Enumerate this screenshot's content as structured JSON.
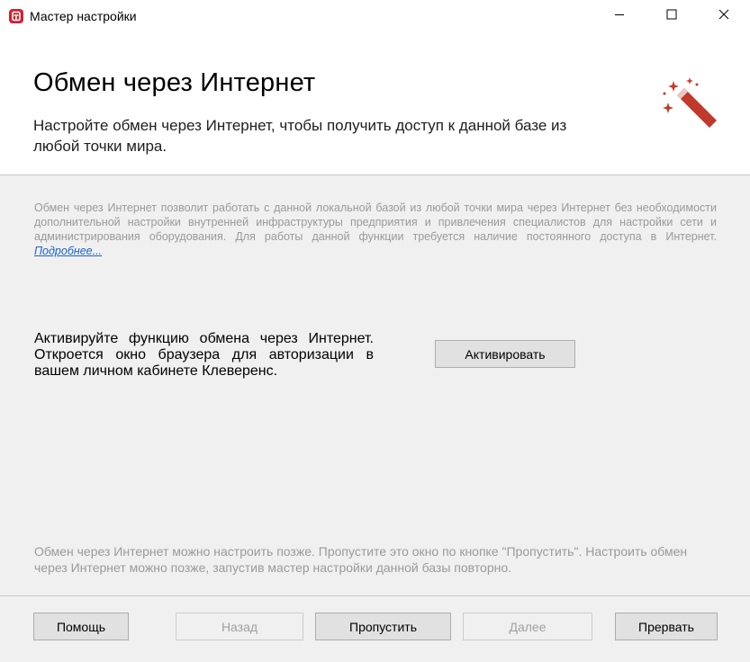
{
  "window": {
    "title": "Мастер настройки",
    "icon": "app-logo-icon",
    "controls": [
      "minimize-icon",
      "maximize-icon",
      "close-icon"
    ]
  },
  "header": {
    "title": "Обмен через Интернет",
    "subtitle": "Настройте обмен через Интернет, чтобы получить доступ к данной базе из любой точки мира.",
    "icon": "magic-wand-icon"
  },
  "info": {
    "text": "Обмен через Интернет позволит работать с данной локальной базой из любой точки мира через Интернет без необходимости дополнительной настройки внутренней инфраструктуры предприятия и привлечения специалистов для настройки сети и администрирования оборудования. Для работы данной функции требуется наличие постоянного доступа в Интернет. ",
    "link": "Подробнее..."
  },
  "activate": {
    "text": "Активируйте функцию обмена через Интернет. Откроется окно браузера для авторизации в вашем личном кабинете Клеверенс.",
    "button": "Активировать"
  },
  "later_text": "Обмен через Интернет можно настроить позже. Пропустите это окно по кнопке \"Пропустить\". Настроить обмен через Интернет можно позже, запустив мастер настройки данной базы повторно.",
  "footer": {
    "help": "Помощь",
    "back": "Назад",
    "skip": "Пропустить",
    "next": "Далее",
    "abort": "Прервать"
  },
  "colors": {
    "accent": "#c0392b",
    "link": "#1d63c4",
    "muted_text": "#9a9a9a"
  }
}
